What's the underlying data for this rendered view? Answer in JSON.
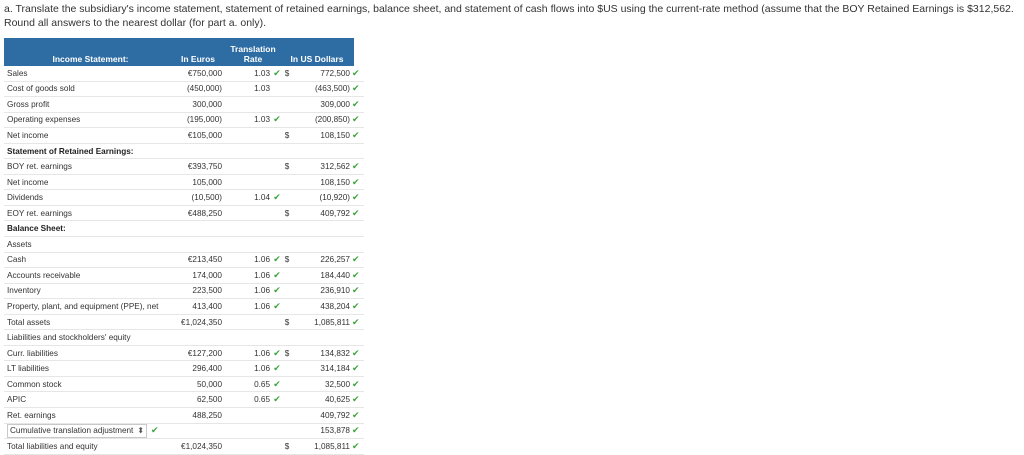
{
  "instructions": {
    "line1": "a. Translate the subsidiary's income statement, statement of retained earnings, balance sheet, and statement of cash flows into $US using the current-rate method (assume that the BOY Retained Earnings is $312,562.",
    "line2": "Round all answers to the nearest dollar (for part a. only)."
  },
  "headers": {
    "col1": "Income Statement:",
    "col2": "In Euros",
    "col3": "Translation Rate",
    "col5": "In US Dollars"
  },
  "rows": [
    {
      "label": "Sales",
      "euros": "€750,000",
      "rate": "1.03",
      "dollar": "$",
      "usd": "772,500",
      "usdcheck": "✔",
      "ratecheck": "✔"
    },
    {
      "label": "Cost of goods sold",
      "euros": "(450,000)",
      "rate": "1.03",
      "dollar": "",
      "usd": "(463,500)",
      "usdcheck": "✔",
      "ratecheck": ""
    },
    {
      "label": "Gross profit",
      "euros": "300,000",
      "rate": "",
      "dollar": "",
      "usd": "309,000",
      "usdcheck": "✔",
      "ratecheck": ""
    },
    {
      "label": "Operating expenses",
      "euros": "(195,000)",
      "rate": "1.03",
      "dollar": "",
      "usd": "(200,850)",
      "usdcheck": "✔",
      "ratecheck": "✔"
    },
    {
      "label": "Net income",
      "euros": "€105,000",
      "rate": "",
      "dollar": "$",
      "usd": "108,150",
      "usdcheck": "✔",
      "ratecheck": ""
    },
    {
      "section": "Statement of Retained Earnings:"
    },
    {
      "label": "BOY ret. earnings",
      "euros": "€393,750",
      "rate": "",
      "dollar": "$",
      "usd": "312,562",
      "usdcheck": "✔",
      "ratecheck": ""
    },
    {
      "label": "Net income",
      "euros": "105,000",
      "rate": "",
      "dollar": "",
      "usd": "108,150",
      "usdcheck": "✔",
      "ratecheck": ""
    },
    {
      "label": "Dividends",
      "euros": "(10,500)",
      "rate": "1.04",
      "dollar": "",
      "usd": "(10,920)",
      "usdcheck": "✔",
      "ratecheck": "✔"
    },
    {
      "label": "EOY ret. earnings",
      "euros": "€488,250",
      "rate": "",
      "dollar": "$",
      "usd": "409,792",
      "usdcheck": "✔",
      "ratecheck": ""
    },
    {
      "section": "Balance Sheet:"
    },
    {
      "label": "Assets",
      "plain": true
    },
    {
      "label": "Cash",
      "euros": "€213,450",
      "rate": "1.06",
      "dollar": "$",
      "usd": "226,257",
      "usdcheck": "✔",
      "ratecheck": "✔"
    },
    {
      "label": "Accounts receivable",
      "euros": "174,000",
      "rate": "1.06",
      "dollar": "",
      "usd": "184,440",
      "usdcheck": "✔",
      "ratecheck": "✔"
    },
    {
      "label": "Inventory",
      "euros": "223,500",
      "rate": "1.06",
      "dollar": "",
      "usd": "236,910",
      "usdcheck": "✔",
      "ratecheck": "✔"
    },
    {
      "label": "Property, plant, and equipment (PPE), net",
      "euros": "413,400",
      "rate": "1.06",
      "dollar": "",
      "usd": "438,204",
      "usdcheck": "✔",
      "ratecheck": "✔"
    },
    {
      "label": "Total assets",
      "euros": "€1,024,350",
      "rate": "",
      "dollar": "$",
      "usd": "1,085,811",
      "usdcheck": "✔",
      "ratecheck": ""
    },
    {
      "label": "Liabilities and stockholders' equity",
      "plain": true
    },
    {
      "label": "Curr. liabilities",
      "euros": "€127,200",
      "rate": "1.06",
      "dollar": "$",
      "usd": "134,832",
      "usdcheck": "✔",
      "ratecheck": "✔"
    },
    {
      "label": "LT liabilities",
      "euros": "296,400",
      "rate": "1.06",
      "dollar": "",
      "usd": "314,184",
      "usdcheck": "✔",
      "ratecheck": "✔"
    },
    {
      "label": "Common stock",
      "euros": "50,000",
      "rate": "0.65",
      "dollar": "",
      "usd": "32,500",
      "usdcheck": "✔",
      "ratecheck": "✔"
    },
    {
      "label": "APIC",
      "euros": "62,500",
      "rate": "0.65",
      "dollar": "",
      "usd": "40,625",
      "usdcheck": "✔",
      "ratecheck": "✔"
    },
    {
      "label": "Ret. earnings",
      "euros": "488,250",
      "rate": "",
      "dollar": "",
      "usd": "409,792",
      "usdcheck": "✔",
      "ratecheck": ""
    },
    {
      "label": "Cumulative translation adjustment",
      "euros": "",
      "rate": "",
      "dollar": "",
      "usd": "153,878",
      "usdcheck": "✔",
      "ratecheck": "",
      "select": true
    },
    {
      "label": "Total liabilities and equity",
      "euros": "€1,024,350",
      "rate": "",
      "dollar": "$",
      "usd": "1,085,811",
      "usdcheck": "✔",
      "ratecheck": ""
    }
  ]
}
